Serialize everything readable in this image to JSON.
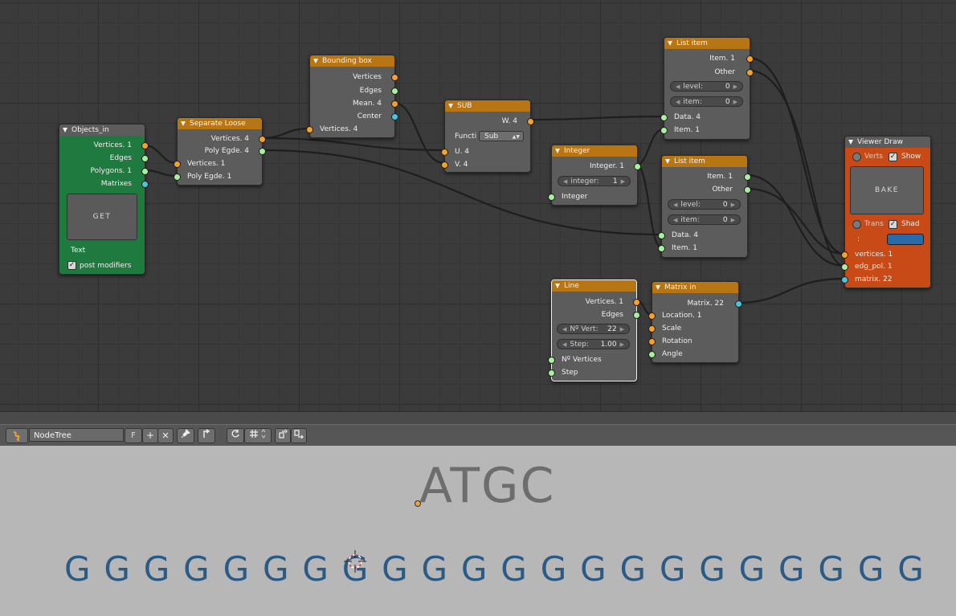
{
  "nodes": {
    "objects_in": {
      "title": "Objects_in",
      "outputs": [
        "Vertices. 1",
        "Edges",
        "Polygons. 1",
        "Matrixes"
      ],
      "get_button": "GET",
      "text_label": "Text",
      "post_modifiers_label": "post modifiers",
      "post_modifiers_checked": true
    },
    "separate_loose": {
      "title": "Separate Loose",
      "outputs": [
        "Vertices. 4",
        "Poly Egde. 4"
      ],
      "inputs": [
        "Vertices. 1",
        "Poly Egde. 1"
      ]
    },
    "bounding_box": {
      "title": "Bounding box",
      "outputs": [
        "Vertices",
        "Edges",
        "Mean. 4",
        "Center"
      ],
      "inputs": [
        "Vertices. 4"
      ]
    },
    "sub": {
      "title": "SUB",
      "outputs": [
        "W. 4"
      ],
      "func_label": "Functi",
      "func_value": "Sub",
      "inputs": [
        "U. 4",
        "V. 4"
      ]
    },
    "integer": {
      "title": "Integer",
      "outputs": [
        "Integer. 1"
      ],
      "field_label": "integer:",
      "field_value": "1",
      "inputs": [
        "Integer"
      ]
    },
    "list_item_1": {
      "title": "List item",
      "outputs": [
        "Item. 1",
        "Other"
      ],
      "level_label": "level:",
      "level_value": "0",
      "item_label": "item:",
      "item_value": "0",
      "inputs": [
        "Data. 4",
        "Item. 1"
      ]
    },
    "list_item_2": {
      "title": "List item",
      "outputs": [
        "Item. 1",
        "Other"
      ],
      "level_label": "level:",
      "level_value": "0",
      "item_label": "item:",
      "item_value": "0",
      "inputs": [
        "Data. 4",
        "Item. 1"
      ]
    },
    "viewer_draw": {
      "title": "Viewer Draw",
      "verts_label": "Verts",
      "show_label": "Show",
      "bake_button": "BAKE",
      "trans_label": "Trans",
      "shad_label": "Shad",
      "color_label": ":",
      "inputs": [
        "vertices. 1",
        "edg_pol. 1",
        "matrix. 22"
      ]
    },
    "line": {
      "title": "Line",
      "outputs": [
        "Vertices. 1",
        "Edges"
      ],
      "nvert_label": "Nº Vert:",
      "nvert_value": "22",
      "step_label": "Step:",
      "step_value": "1.00",
      "inputs": [
        "Nº Vertices",
        "Step"
      ]
    },
    "matrix_in": {
      "title": "Matrix in",
      "outputs": [
        "Matrix. 22"
      ],
      "inputs": [
        "Location. 1",
        "Scale",
        "Rotation",
        "Angle"
      ]
    }
  },
  "toolbar": {
    "tree_name": "NodeTree",
    "fake_user_label": "F",
    "add_label": "+",
    "close_label": "✕"
  },
  "viewport": {
    "title_text": "ATGC",
    "g_row": [
      "G",
      "G",
      "G",
      "G",
      "G",
      "G",
      "G",
      "G",
      "G",
      "G",
      "G",
      "G",
      "G",
      "G",
      "G",
      "G",
      "G",
      "G",
      "G",
      "G",
      "G",
      "G"
    ]
  },
  "colors": {
    "node_header": "#b87514",
    "objects_in_body": "#1f7a3f",
    "viewer_draw_body": "#c84a16",
    "socket_vertices": "#f5a030",
    "socket_data": "#a6f0a0",
    "socket_matrix": "#4cc4dc",
    "g_row_text": "#2a5a86"
  }
}
